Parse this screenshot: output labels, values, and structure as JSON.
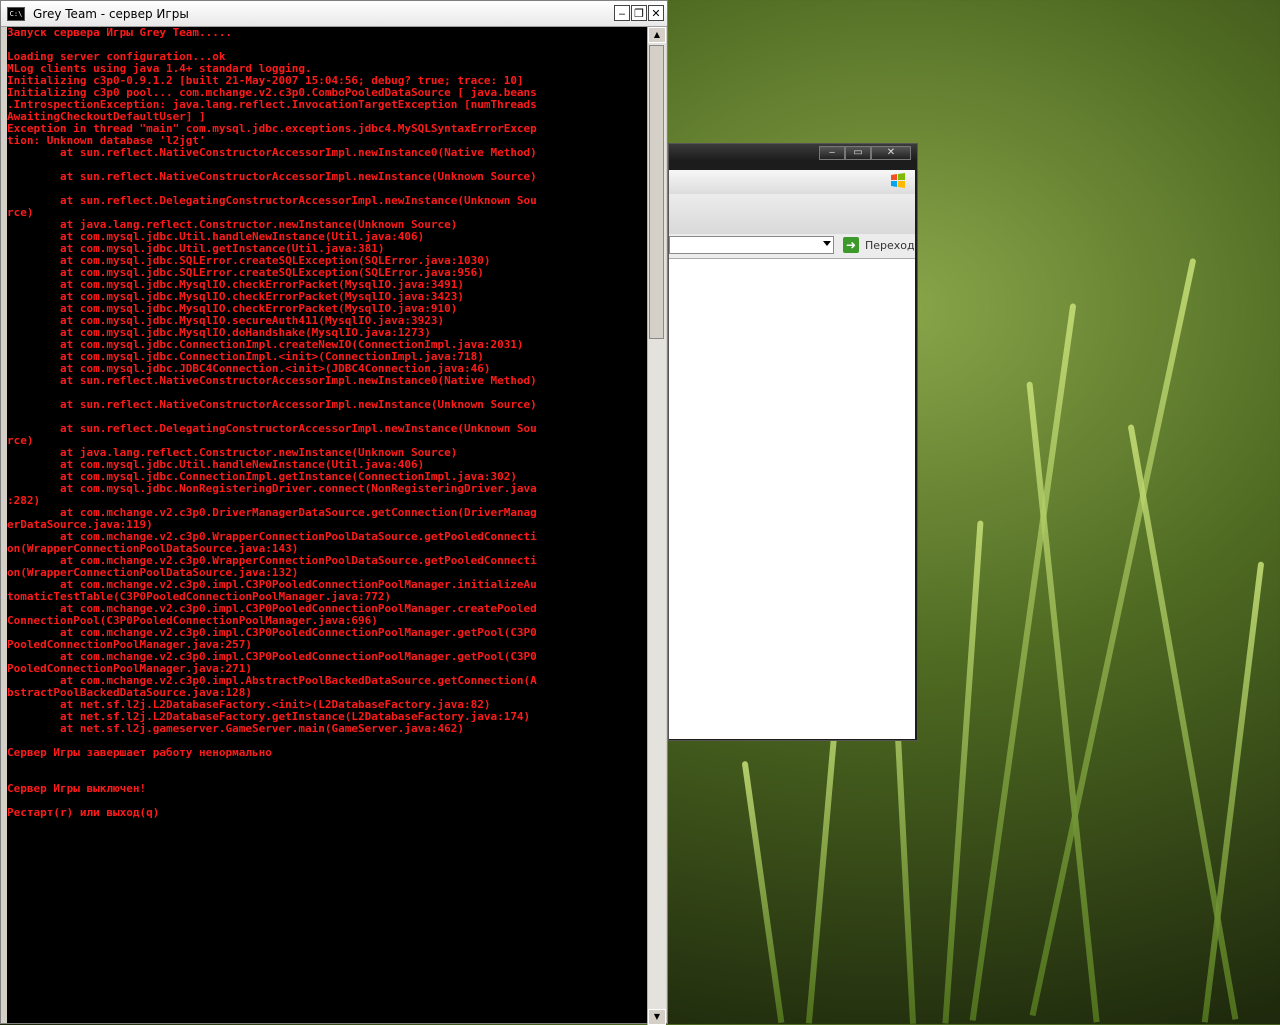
{
  "console": {
    "title": "Grey Team - сервер Игры",
    "icon_text": "C:\\",
    "buttons": {
      "minimize": "‒",
      "restore": "❐",
      "close": "✕"
    },
    "lines": [
      "Запуск сервера Игры Grey Team.....",
      "",
      "Loading server configuration...ok",
      "MLog clients using java 1.4+ standard logging.",
      "Initializing c3p0-0.9.1.2 [built 21-May-2007 15:04:56; debug? true; trace: 10]",
      "Initializing c3p0 pool... com.mchange.v2.c3p0.ComboPooledDataSource [ java.beans",
      ".IntrospectionException: java.lang.reflect.InvocationTargetException [numThreads",
      "AwaitingCheckoutDefaultUser] ]",
      "Exception in thread \"main\" com.mysql.jdbc.exceptions.jdbc4.MySQLSyntaxErrorExcep",
      "tion: Unknown database 'l2jgt'",
      "        at sun.reflect.NativeConstructorAccessorImpl.newInstance0(Native Method)",
      "",
      "        at sun.reflect.NativeConstructorAccessorImpl.newInstance(Unknown Source)",
      "",
      "        at sun.reflect.DelegatingConstructorAccessorImpl.newInstance(Unknown Sou",
      "rce)",
      "        at java.lang.reflect.Constructor.newInstance(Unknown Source)",
      "        at com.mysql.jdbc.Util.handleNewInstance(Util.java:406)",
      "        at com.mysql.jdbc.Util.getInstance(Util.java:381)",
      "        at com.mysql.jdbc.SQLError.createSQLException(SQLError.java:1030)",
      "        at com.mysql.jdbc.SQLError.createSQLException(SQLError.java:956)",
      "        at com.mysql.jdbc.MysqlIO.checkErrorPacket(MysqlIO.java:3491)",
      "        at com.mysql.jdbc.MysqlIO.checkErrorPacket(MysqlIO.java:3423)",
      "        at com.mysql.jdbc.MysqlIO.checkErrorPacket(MysqlIO.java:910)",
      "        at com.mysql.jdbc.MysqlIO.secureAuth411(MysqlIO.java:3923)",
      "        at com.mysql.jdbc.MysqlIO.doHandshake(MysqlIO.java:1273)",
      "        at com.mysql.jdbc.ConnectionImpl.createNewIO(ConnectionImpl.java:2031)",
      "        at com.mysql.jdbc.ConnectionImpl.<init>(ConnectionImpl.java:718)",
      "        at com.mysql.jdbc.JDBC4Connection.<init>(JDBC4Connection.java:46)",
      "        at sun.reflect.NativeConstructorAccessorImpl.newInstance0(Native Method)",
      "",
      "        at sun.reflect.NativeConstructorAccessorImpl.newInstance(Unknown Source)",
      "",
      "        at sun.reflect.DelegatingConstructorAccessorImpl.newInstance(Unknown Sou",
      "rce)",
      "        at java.lang.reflect.Constructor.newInstance(Unknown Source)",
      "        at com.mysql.jdbc.Util.handleNewInstance(Util.java:406)",
      "        at com.mysql.jdbc.ConnectionImpl.getInstance(ConnectionImpl.java:302)",
      "        at com.mysql.jdbc.NonRegisteringDriver.connect(NonRegisteringDriver.java",
      ":282)",
      "        at com.mchange.v2.c3p0.DriverManagerDataSource.getConnection(DriverManag",
      "erDataSource.java:119)",
      "        at com.mchange.v2.c3p0.WrapperConnectionPoolDataSource.getPooledConnecti",
      "on(WrapperConnectionPoolDataSource.java:143)",
      "        at com.mchange.v2.c3p0.WrapperConnectionPoolDataSource.getPooledConnecti",
      "on(WrapperConnectionPoolDataSource.java:132)",
      "        at com.mchange.v2.c3p0.impl.C3P0PooledConnectionPoolManager.initializeAu",
      "tomaticTestTable(C3P0PooledConnectionPoolManager.java:772)",
      "        at com.mchange.v2.c3p0.impl.C3P0PooledConnectionPoolManager.createPooled",
      "ConnectionPool(C3P0PooledConnectionPoolManager.java:696)",
      "        at com.mchange.v2.c3p0.impl.C3P0PooledConnectionPoolManager.getPool(C3P0",
      "PooledConnectionPoolManager.java:257)",
      "        at com.mchange.v2.c3p0.impl.C3P0PooledConnectionPoolManager.getPool(C3P0",
      "PooledConnectionPoolManager.java:271)",
      "        at com.mchange.v2.c3p0.impl.AbstractPoolBackedDataSource.getConnection(A",
      "bstractPoolBackedDataSource.java:128)",
      "        at net.sf.l2j.L2DatabaseFactory.<init>(L2DatabaseFactory.java:82)",
      "        at net.sf.l2j.L2DatabaseFactory.getInstance(L2DatabaseFactory.java:174)",
      "        at net.sf.l2j.gameserver.GameServer.main(GameServer.java:462)",
      "",
      "Сервер Игры завершает работу ненормально",
      "",
      "",
      "Сервер Игры выключен!",
      "",
      "Рестарт(r) или выход(q)"
    ]
  },
  "browser": {
    "go_label": "Переход",
    "go_icon": "arrow-right-icon",
    "buttons": {
      "minimize": "‒",
      "maximize": "▭",
      "close": "✕"
    }
  }
}
